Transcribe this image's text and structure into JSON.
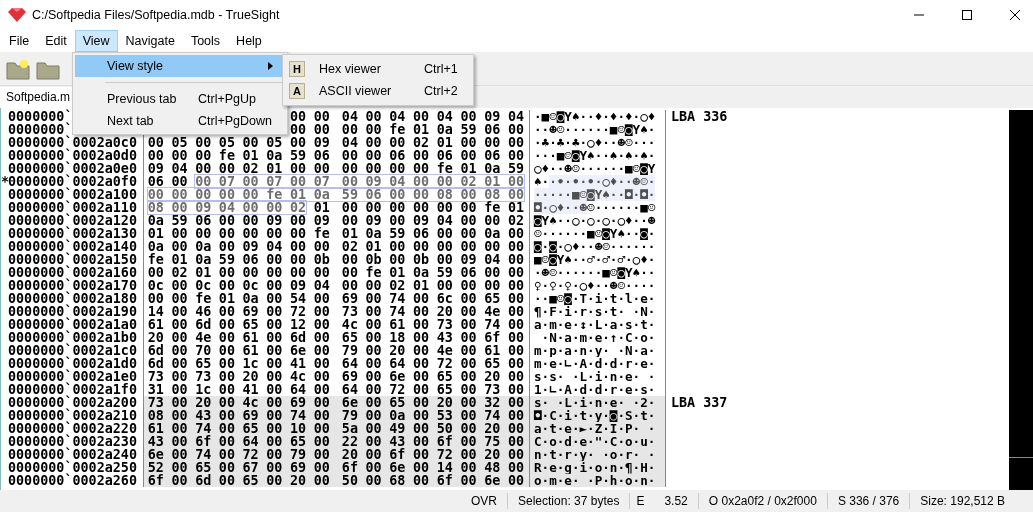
{
  "window": {
    "title": "C:/Softpedia Files/Softpedia.mdb - TrueSight"
  },
  "menu_bar": [
    {
      "label": "File",
      "selected": false
    },
    {
      "label": "Edit",
      "selected": false
    },
    {
      "label": "View",
      "selected": true
    },
    {
      "label": "Navigate",
      "selected": false
    },
    {
      "label": "Tools",
      "selected": false
    },
    {
      "label": "Help",
      "selected": false
    }
  ],
  "view_menu": [
    {
      "kind": "submenu",
      "label": "View style",
      "selected": true
    },
    {
      "kind": "separator"
    },
    {
      "kind": "command",
      "label": "Previous tab",
      "shortcut": "Ctrl+PgUp",
      "selected": false
    },
    {
      "kind": "command",
      "label": "Next tab",
      "shortcut": "Ctrl+PgDown",
      "selected": false
    }
  ],
  "view_style_submenu": [
    {
      "icon_letter": "H",
      "label": "Hex viewer",
      "shortcut": "Ctrl+1"
    },
    {
      "icon_letter": "A",
      "label": "ASCII viewer",
      "shortcut": "Ctrl+2"
    }
  ],
  "tabs": [
    {
      "label": "Softpedia.m",
      "selected": true
    }
  ],
  "rows": [
    {
      "address": "0000000`",
      "shaded": false,
      "hex": [
        {
          "text": "00 00 04 00 04 00 04 00 09 04",
          "selected": false
        }
      ],
      "ascii": [
        {
          "text": "·■☺◙Y♠··♦·♦·♦·○♦",
          "selected": false
        }
      ],
      "lba": "LBA 336"
    },
    {
      "address": "0000000`",
      "shaded": false,
      "hex": [
        {
          "text": "00 00 00 00 fe 01 0a 59 06 00",
          "selected": false
        }
      ],
      "ascii": [
        {
          "text": "··☻☺······■☺◙Y♠·",
          "selected": false
        }
      ]
    },
    {
      "address": "0000000`0002a0c0",
      "shaded": false,
      "hex": [
        {
          "text": "00 05 00 05 00 05 00 09 04 00 00 02 01 00 00 00",
          "selected": false
        }
      ],
      "ascii": [
        {
          "text": "·♣·♣·♣·○♦··☻☺···",
          "selected": false
        }
      ]
    },
    {
      "address": "0000000`0002a0d0",
      "shaded": false,
      "hex": [
        {
          "text": "00 00 00 fe 01 0a 59 06 00 00 06 00 06 00 06 00",
          "selected": false
        }
      ],
      "ascii": [
        {
          "text": "···■☺◙Y♠··♠·♠·♠·",
          "selected": false
        }
      ]
    },
    {
      "address": "0000000`0002a0e0",
      "shaded": false,
      "hex": [
        {
          "text": "09 04 00 00 02 01 00 00 00 00 00 00 fe 01 0a 59",
          "selected": false
        }
      ],
      "ascii": [
        {
          "text": "○♦··☻☺······■☺◙Y",
          "selected": false
        }
      ]
    },
    {
      "marker": "*",
      "address": "0000000`0002a0f0",
      "shaded": false,
      "hex": [
        {
          "text": "06 00",
          "selected": false
        },
        {
          "text": "00 07 00 07 00 07 00 09 04 00 00 02 01 00",
          "selected": true
        }
      ],
      "ascii": [
        {
          "text": "♠·",
          "selected": false
        },
        {
          "text": "·•·•·•·○♦··☻☺·",
          "selected": true
        }
      ]
    },
    {
      "address": "0000000`0002a100",
      "shaded": false,
      "hex": [
        {
          "text": "00 00 00 00 00 fe 01 0a 59 06 00 00 08 00 08 00",
          "selected": true
        }
      ],
      "ascii": [
        {
          "text": "·····■☺◙Y♠··◘·◘·",
          "selected": true
        }
      ]
    },
    {
      "address": "0000000`0002a110",
      "shaded": false,
      "hex": [
        {
          "text": "08 00 09 04 00 00 02",
          "selected": true
        },
        {
          "text": "01 00 00 00 00 00 00 fe 01",
          "selected": false
        }
      ],
      "ascii": [
        {
          "text": "◘·○♦··☻",
          "selected": true
        },
        {
          "text": "☺······■☺",
          "selected": false
        }
      ]
    },
    {
      "address": "0000000`0002a120",
      "shaded": false,
      "hex": [
        {
          "text": "0a 59 06 00 00 09 00 09 00 09 00 09 04 00 00 02",
          "selected": false
        }
      ],
      "ascii": [
        {
          "text": "◙Y♠··○·○·○·○♦··☻",
          "selected": false
        }
      ]
    },
    {
      "address": "0000000`0002a130",
      "shaded": false,
      "hex": [
        {
          "text": "01 00 00 00 00 00 00 fe 01 0a 59 06 00 00 0a 00",
          "selected": false
        }
      ],
      "ascii": [
        {
          "text": "☺······■☺◙Y♠··◙·",
          "selected": false
        }
      ]
    },
    {
      "address": "0000000`0002a140",
      "shaded": false,
      "hex": [
        {
          "text": "0a 00 0a 00 09 04 00 00 02 01 00 00 00 00 00 00",
          "selected": false
        }
      ],
      "ascii": [
        {
          "text": "◙·◙·○♦··☻☺······",
          "selected": false
        }
      ]
    },
    {
      "address": "0000000`0002a150",
      "shaded": false,
      "hex": [
        {
          "text": "fe 01 0a 59 06 00 00 0b 00 0b 00 0b 00 09 04 00",
          "selected": false
        }
      ],
      "ascii": [
        {
          "text": "■☺◙Y♠··♂·♂·♂·○♦·",
          "selected": false
        }
      ]
    },
    {
      "address": "0000000`0002a160",
      "shaded": false,
      "hex": [
        {
          "text": "00 02 01 00 00 00 00 00 00 fe 01 0a 59 06 00 00",
          "selected": false
        }
      ],
      "ascii": [
        {
          "text": "·☻☺······■☺◙Y♠··",
          "selected": false
        }
      ]
    },
    {
      "address": "0000000`0002a170",
      "shaded": false,
      "hex": [
        {
          "text": "0c 00 0c 00 0c 00 09 04 00 00 02 01 00 00 00 00",
          "selected": false
        }
      ],
      "ascii": [
        {
          "text": "♀·♀·♀·○♦··☻☺····",
          "selected": false
        }
      ]
    },
    {
      "address": "0000000`0002a180",
      "shaded": false,
      "hex": [
        {
          "text": "00 00 fe 01 0a 00 54 00 69 00 74 00 6c 00 65 00",
          "selected": false
        }
      ],
      "ascii": [
        {
          "text": "··■☺◙·T·i·t·l·e·",
          "selected": false
        }
      ]
    },
    {
      "address": "0000000`0002a190",
      "shaded": false,
      "hex": [
        {
          "text": "14 00 46 00 69 00 72 00 73 00 74 00 20 00 4e 00",
          "selected": false
        }
      ],
      "ascii": [
        {
          "text": "¶·F·i·r·s·t· ·N·",
          "selected": false
        }
      ]
    },
    {
      "address": "0000000`0002a1a0",
      "shaded": false,
      "hex": [
        {
          "text": "61 00 6d 00 65 00 12 00 4c 00 61 00 73 00 74 00",
          "selected": false
        }
      ],
      "ascii": [
        {
          "text": "a·m·e·↕·L·a·s·t·",
          "selected": false
        }
      ]
    },
    {
      "address": "0000000`0002a1b0",
      "shaded": false,
      "hex": [
        {
          "text": "20 00 4e 00 61 00 6d 00 65 00 18 00 43 00 6f 00",
          "selected": false
        }
      ],
      "ascii": [
        {
          "text": " ·N·a·m·e·↑·C·o·",
          "selected": false
        }
      ]
    },
    {
      "address": "0000000`0002a1c0",
      "shaded": false,
      "hex": [
        {
          "text": "6d 00 70 00 61 00 6e 00 79 00 20 00 4e 00 61 00",
          "selected": false
        }
      ],
      "ascii": [
        {
          "text": "m·p·a·n·y· ·N·a·",
          "selected": false
        }
      ]
    },
    {
      "address": "0000000`0002a1d0",
      "shaded": false,
      "hex": [
        {
          "text": "6d 00 65 00 1c 00 41 00 64 00 64 00 72 00 65 00",
          "selected": false
        }
      ],
      "ascii": [
        {
          "text": "m·e·∟·A·d·d·r·e·",
          "selected": false
        }
      ]
    },
    {
      "address": "0000000`0002a1e0",
      "shaded": false,
      "hex": [
        {
          "text": "73 00 73 00 20 00 4c 00 69 00 6e 00 65 00 20 00",
          "selected": false
        }
      ],
      "ascii": [
        {
          "text": "s·s· ·L·i·n·e· ·",
          "selected": false
        }
      ]
    },
    {
      "address": "0000000`0002a1f0",
      "shaded": false,
      "hex": [
        {
          "text": "31 00 1c 00 41 00 64 00 64 00 72 00 65 00 73 00",
          "selected": false
        }
      ],
      "ascii": [
        {
          "text": "1·∟·A·d·d·r·e·s·",
          "selected": false
        }
      ]
    },
    {
      "address": "0000000`0002a200",
      "shaded": true,
      "hex": [
        {
          "text": "73 00 20 00 4c 00 69 00 6e 00 65 00 20 00 32 00",
          "selected": false
        }
      ],
      "ascii": [
        {
          "text": "s· ·L·i·n·e· ·2·",
          "selected": false
        }
      ],
      "lba": "LBA 337"
    },
    {
      "address": "0000000`0002a210",
      "shaded": true,
      "hex": [
        {
          "text": "08 00 43 00 69 00 74 00 79 00 0a 00 53 00 74 00",
          "selected": false
        }
      ],
      "ascii": [
        {
          "text": "◘·C·i·t·y·◙·S·t·",
          "selected": false
        }
      ]
    },
    {
      "address": "0000000`0002a220",
      "shaded": true,
      "hex": [
        {
          "text": "61 00 74 00 65 00 10 00 5a 00 49 00 50 00 20 00",
          "selected": false
        }
      ],
      "ascii": [
        {
          "text": "a·t·e·►·Z·I·P· ·",
          "selected": false
        }
      ]
    },
    {
      "address": "0000000`0002a230",
      "shaded": true,
      "hex": [
        {
          "text": "43 00 6f 00 64 00 65 00 22 00 43 00 6f 00 75 00",
          "selected": false
        }
      ],
      "ascii": [
        {
          "text": "C·o·d·e·\"·C·o·u·",
          "selected": false
        }
      ]
    },
    {
      "address": "0000000`0002a240",
      "shaded": true,
      "hex": [
        {
          "text": "6e 00 74 00 72 00 79 00 20 00 6f 00 72 00 20 00",
          "selected": false
        }
      ],
      "ascii": [
        {
          "text": "n·t·r·y· ·o·r· ·",
          "selected": false
        }
      ]
    },
    {
      "address": "0000000`0002a250",
      "shaded": true,
      "hex": [
        {
          "text": "52 00 65 00 67 00 69 00 6f 00 6e 00 14 00 48 00",
          "selected": false
        }
      ],
      "ascii": [
        {
          "text": "R·e·g·i·o·n·¶·H·",
          "selected": false
        }
      ]
    },
    {
      "address": "0000000`0002a260",
      "shaded": true,
      "hex": [
        {
          "text": "6f 00 6d 00 65 00 20 00 50 00 68 00 6f 00 6e 00",
          "selected": false
        }
      ],
      "ascii": [
        {
          "text": "o·m·e· ·P·h·o·n·",
          "selected": false
        }
      ]
    }
  ],
  "status_bar": {
    "mode": "OVR",
    "selection": "Selection: 37 bytes",
    "entropy_label": "E",
    "entropy": "3.52",
    "offset": "O  0x2a0f2  /  0x2f000",
    "sector": "S  336  /  376",
    "size": "Size: 192,512 B"
  }
}
